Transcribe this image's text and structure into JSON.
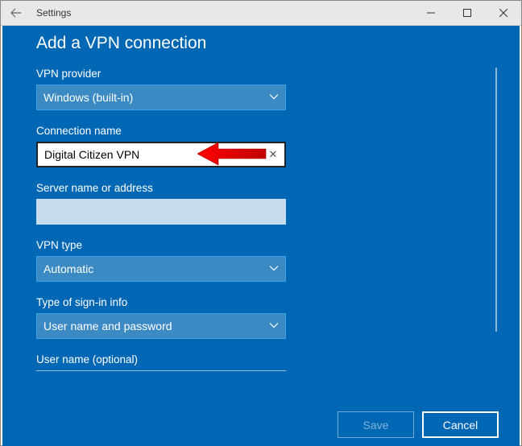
{
  "window": {
    "title": "Settings"
  },
  "panel": {
    "title": "Add a VPN connection"
  },
  "fields": {
    "provider": {
      "label": "VPN provider",
      "value": "Windows (built-in)"
    },
    "connection_name": {
      "label": "Connection name",
      "value": "Digital Citizen VPN",
      "clear_glyph": "✕"
    },
    "server": {
      "label": "Server name or address",
      "value": ""
    },
    "vpn_type": {
      "label": "VPN type",
      "value": "Automatic"
    },
    "signin": {
      "label": "Type of sign-in info",
      "value": "User name and password"
    },
    "username": {
      "label": "User name (optional)"
    }
  },
  "footer": {
    "save": "Save",
    "cancel": "Cancel"
  }
}
